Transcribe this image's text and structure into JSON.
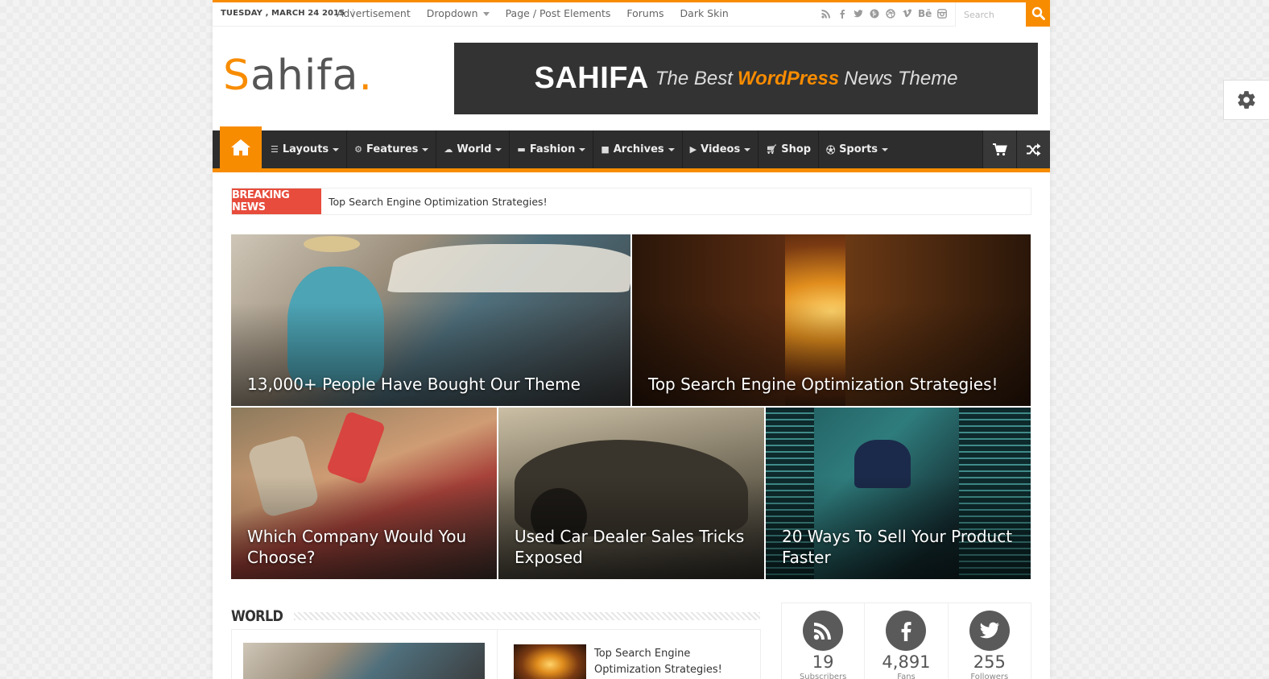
{
  "topbar": {
    "date": "TUESDAY , MARCH 24 2015",
    "links": [
      "Advertisement",
      "Dropdown",
      "Page / Post Elements",
      "Forums",
      "Dark Skin"
    ],
    "search_placeholder": "Search",
    "social_icons": [
      "rss-icon",
      "facebook-icon",
      "twitter-icon",
      "pinterest-icon",
      "dribbble-icon",
      "vimeo-icon",
      "behance-icon",
      "instagram-icon"
    ]
  },
  "header": {
    "logo_text": "ahifa",
    "logo_first": "S",
    "logo_dot": ".",
    "banner": {
      "brand": "SAHIFA",
      "part1": "The Best",
      "highlight": "WordPress",
      "part2": "News Theme"
    }
  },
  "nav": {
    "items": [
      {
        "label": "Layouts",
        "icon": "menu-icon"
      },
      {
        "label": "Features",
        "icon": "cogs-icon"
      },
      {
        "label": "World",
        "icon": "cloud-icon"
      },
      {
        "label": "Fashion",
        "icon": "briefcase-icon"
      },
      {
        "label": "Archives",
        "icon": "folder-icon"
      },
      {
        "label": "Videos",
        "icon": "play-icon"
      },
      {
        "label": "Shop",
        "icon": "cart-icon"
      },
      {
        "label": "Sports",
        "icon": "ball-icon"
      }
    ]
  },
  "breaking": {
    "label": "BREAKING NEWS",
    "headline": "Top Search Engine Optimization Strategies!"
  },
  "slider": {
    "tiles": [
      "13,000+ People Have Bought Our Theme",
      "Top Search Engine Optimization Strategies!",
      "Which Company Would You Choose?",
      "Used Car Dealer Sales Tricks Exposed",
      "20 Ways To Sell Your Product Faster"
    ]
  },
  "world": {
    "title": "WORLD",
    "side_post_title": "Top Search Engine Optimization Strategies!"
  },
  "counter": [
    {
      "count": "19",
      "label": "Subscribers",
      "icon": "rss-icon"
    },
    {
      "count": "4,891",
      "label": "Fans",
      "icon": "facebook-icon"
    },
    {
      "count": "255",
      "label": "Followers",
      "icon": "twitter-icon"
    }
  ],
  "colors": {
    "accent": "#f88c00",
    "breaking": "#e74c3c",
    "nav_bg": "#2d2d2d"
  }
}
